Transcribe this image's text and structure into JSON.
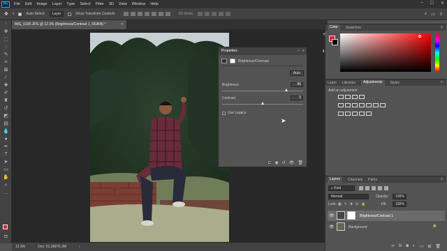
{
  "app": {
    "logo": "Ps"
  },
  "menu": [
    "File",
    "Edit",
    "Image",
    "Layer",
    "Type",
    "Select",
    "Filter",
    "3D",
    "View",
    "Window",
    "Help"
  ],
  "options": {
    "auto_select_label": "Auto-Select:",
    "auto_select_value": "Layer",
    "transform_label": "Show Transform Controls",
    "mode_3d": "3D Mode:"
  },
  "document": {
    "tab_title": "IMG_0185.JPG @ 12.3% (Brightness/Contrast 1, RGB/8) *",
    "zoom": "12.3%",
    "doc_info": "Doc: 51.3M/76.3M"
  },
  "properties": {
    "title": "Properties",
    "layer_type": "Brightness/Contrast",
    "auto_label": "Auto",
    "brightness_label": "Brightness:",
    "brightness_value": "86",
    "contrast_label": "Contrast:",
    "contrast_value": "0",
    "legacy_label": "Use Legacy",
    "brightness_fraction": 0.79,
    "contrast_fraction": 0.5
  },
  "color_panel": {
    "tabs": [
      "Color",
      "Swatches"
    ],
    "hue_color": "#ff0000",
    "foreground": "#e8202a"
  },
  "adjustments_panel": {
    "tabs": [
      "Learn",
      "Libraries",
      "Adjustments",
      "Styles"
    ],
    "add_label": "Add an adjustment"
  },
  "layers_panel": {
    "tabs": [
      "Layers",
      "Channels",
      "Paths"
    ],
    "kind_label": "Kind",
    "blend_mode": "Normal",
    "opacity_label": "Opacity:",
    "opacity_value": "100%",
    "lock_label": "Lock:",
    "fill_label": "Fill:",
    "fill_value": "100%",
    "layers": [
      {
        "name": "Brightness/Contrast 1"
      },
      {
        "name": "Background"
      }
    ]
  }
}
